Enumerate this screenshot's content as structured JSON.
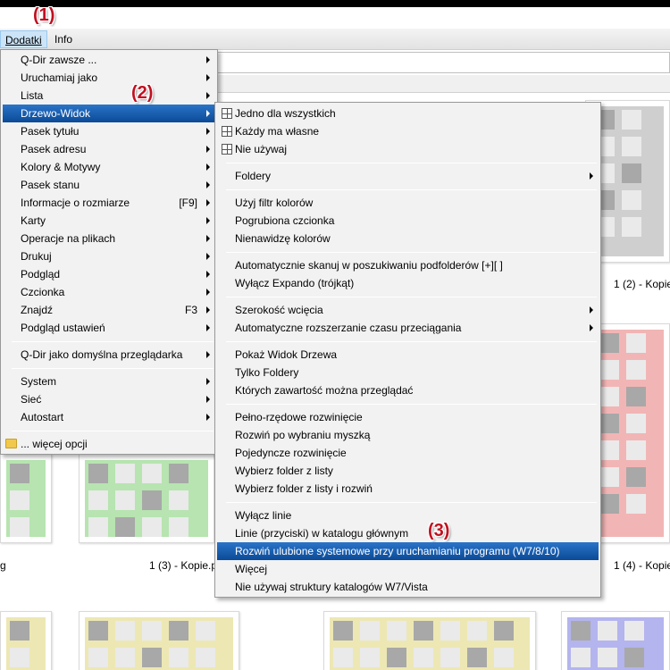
{
  "colors": {
    "green": "#b7e4b0",
    "red": "#f2b5b5",
    "gray": "#cfcfcf",
    "yellow": "#ede7b4",
    "blue": "#b4b4ee",
    "highlight": "#0f5aa8",
    "annotation": "#c01020"
  },
  "menubar": {
    "items": [
      {
        "label": "Dodatki"
      },
      {
        "label": "Info"
      }
    ]
  },
  "annotations": {
    "a1": "(1)",
    "a2": "(2)",
    "a3": "(3)"
  },
  "captions": {
    "c1": "1 (2) - Kopie",
    "c2": "g",
    "c3": "1 (3) - Kopie.p",
    "c4": "1 (4) - Kopie"
  },
  "menu1": {
    "items": [
      {
        "label": "Q-Dir zawsze ...",
        "submenu": true
      },
      {
        "label": "Uruchamiaj jako",
        "submenu": true
      },
      {
        "label": "Lista",
        "submenu": true
      },
      {
        "label": "Drzewo-Widok",
        "submenu": true
      },
      {
        "label": "Pasek tytułu",
        "submenu": true
      },
      {
        "label": "Pasek adresu",
        "submenu": true
      },
      {
        "label": "Kolory & Motywy",
        "submenu": true
      },
      {
        "label": "Pasek stanu",
        "submenu": true
      },
      {
        "label": "Informacje o rozmiarze",
        "shortcut": "[F9]",
        "submenu": true
      },
      {
        "label": "Karty",
        "submenu": true
      },
      {
        "label": "Operacje na plikach",
        "submenu": true
      },
      {
        "label": "Drukuj",
        "submenu": true
      },
      {
        "label": "Podgląd",
        "submenu": true
      },
      {
        "label": "Czcionka",
        "submenu": true
      },
      {
        "label": "Znajdź",
        "shortcut": "F3",
        "submenu": true
      },
      {
        "label": "Podgląd ustawień",
        "submenu": true
      },
      {
        "label": "Q-Dir jako domyślna przeglądarka",
        "submenu": true
      },
      {
        "label": "System",
        "submenu": true
      },
      {
        "label": "Sieć",
        "submenu": true
      },
      {
        "label": "Autostart",
        "submenu": true
      },
      {
        "label": "... więcej opcji",
        "submenu": false
      }
    ]
  },
  "menu2": {
    "items": [
      {
        "label": "Jedno dla wszystkich",
        "icon": "grid-icon"
      },
      {
        "label": "Każdy ma własne",
        "icon": "grid-icon"
      },
      {
        "label": "Nie używaj",
        "icon": "grid-icon"
      },
      {
        "label": "Foldery",
        "submenu": true
      },
      {
        "label": "Użyj filtr kolorów"
      },
      {
        "label": "Pogrubiona czcionka"
      },
      {
        "label": "Nienawidzę kolorów"
      },
      {
        "label": "Automatycznie skanuj w poszukiwaniu podfolderów [+][ ]"
      },
      {
        "label": "Wyłącz Expando (trójkąt)"
      },
      {
        "label": "Szerokość wcięcia",
        "submenu": true
      },
      {
        "label": "Automatyczne rozszerzanie czasu przeciągania",
        "submenu": true
      },
      {
        "label": "Pokaż Widok Drzewa"
      },
      {
        "label": "Tylko Foldery"
      },
      {
        "label": "Których zawartość można przeglądać"
      },
      {
        "label": "Pełno-rzędowe rozwinięcie"
      },
      {
        "label": "Rozwiń po wybraniu myszką"
      },
      {
        "label": "Pojedyncze rozwinięcie"
      },
      {
        "label": "Wybierz folder z listy"
      },
      {
        "label": "Wybierz folder z listy i rozwiń"
      },
      {
        "label": "Wyłącz linie"
      },
      {
        "label": "Linie (przyciski) w katalogu głównym"
      },
      {
        "label": "Rozwiń ulubione systemowe przy uruchamianiu programu (W7/8/10)"
      },
      {
        "label": "Więcej"
      },
      {
        "label": "Nie używaj struktury katalogów W7/Vista"
      }
    ]
  }
}
